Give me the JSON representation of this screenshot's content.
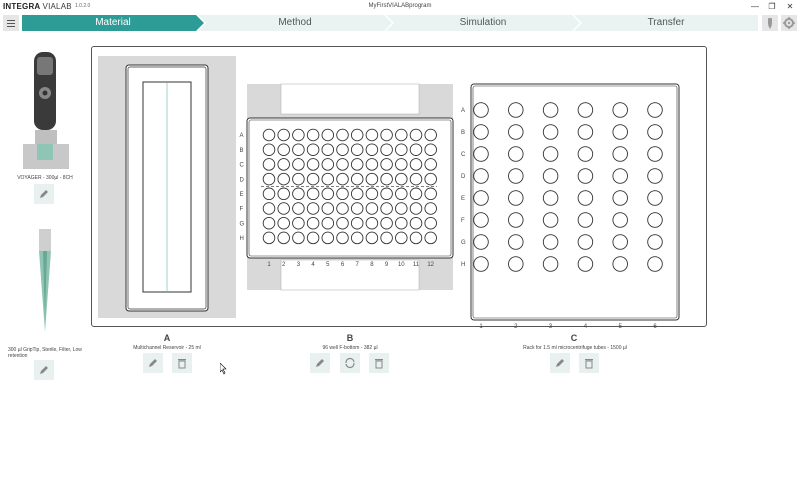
{
  "app": {
    "brand_integra": "INTEGRA",
    "brand_vialab": "VIALAB",
    "version": "1.0.2.0",
    "title": "MyFirstVIALABprogram"
  },
  "window": {
    "minimize": "—",
    "restore": "❐",
    "close": "✕"
  },
  "tabs": [
    {
      "label": "Material",
      "active": true
    },
    {
      "label": "Method",
      "active": false
    },
    {
      "label": "Simulation",
      "active": false
    },
    {
      "label": "Transfer",
      "active": false
    }
  ],
  "pipette": {
    "name": "VOYAGER - 300µl - 8CH"
  },
  "tip": {
    "name": "300 µl GripTip, Sterile, Filter, Low retention"
  },
  "slots": [
    {
      "letter": "A",
      "labware": "Multichannel Reservoir - 25 ml"
    },
    {
      "letter": "B",
      "labware": "96 well F-bottom - 382 µl"
    },
    {
      "letter": "C",
      "labware": "Rack for 1.5 ml microcentrifuge tubes - 1500 µl"
    }
  ],
  "plate96": {
    "rows": [
      "A",
      "B",
      "C",
      "D",
      "E",
      "F",
      "G",
      "H"
    ],
    "cols": [
      "1",
      "2",
      "3",
      "4",
      "5",
      "6",
      "7",
      "8",
      "9",
      "10",
      "11",
      "12"
    ]
  },
  "rack": {
    "rows": [
      "A",
      "B",
      "C",
      "D",
      "E",
      "F",
      "G",
      "H"
    ],
    "cols": [
      "1",
      "2",
      "3",
      "4",
      "5",
      "6"
    ]
  },
  "icons": {
    "edit": "pencil-icon",
    "delete": "trash-icon",
    "rotate": "rotate-icon",
    "menu": "hamburger-icon",
    "settings": "gear-icon",
    "pipette": "pipette-icon"
  },
  "colors": {
    "accent": "#2d9b96",
    "tab_inactive": "#eaf3f2",
    "button_bg": "#e8f1f0"
  }
}
